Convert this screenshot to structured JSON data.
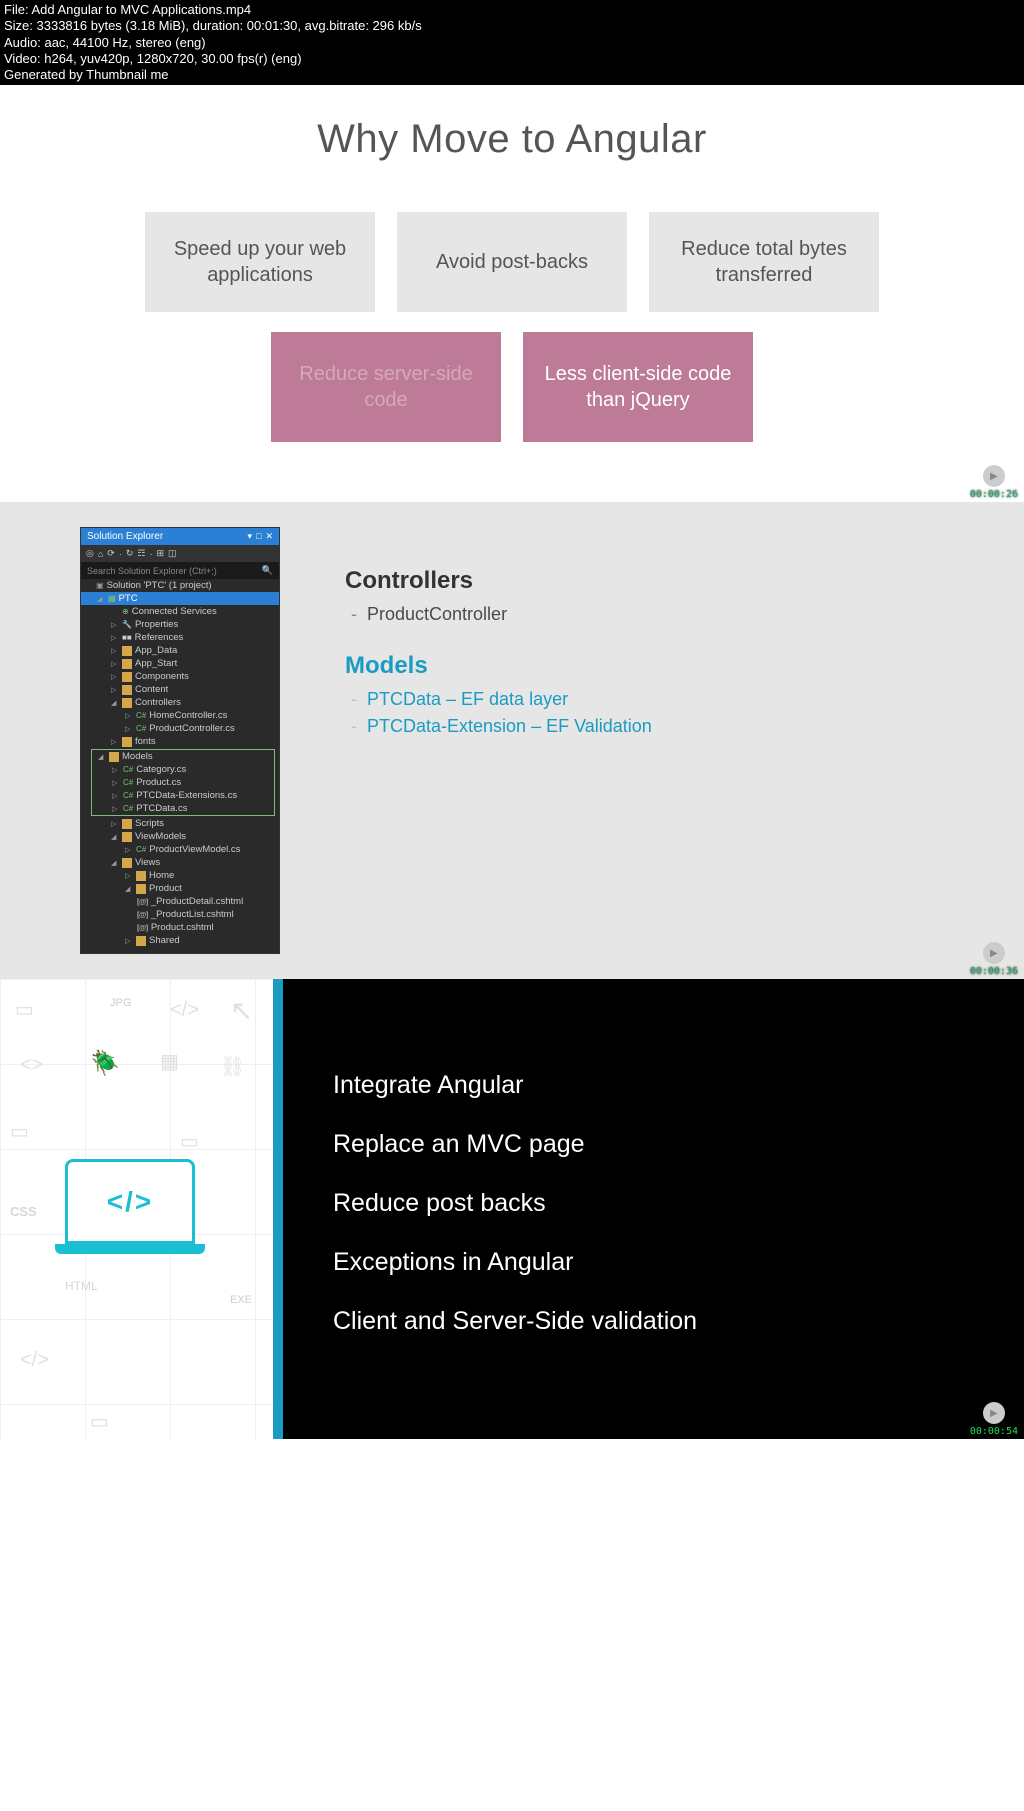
{
  "info": {
    "file_line": "File: Add Angular to MVC Applications.mp4",
    "size_line": "Size: 3333816 bytes (3.18 MiB), duration: 00:01:30, avg.bitrate: 296 kb/s",
    "audio_line": "Audio: aac, 44100 Hz, stereo (eng)",
    "video_line": "Video: h264, yuv420p, 1280x720, 30.00 fps(r) (eng)",
    "gen_line": "Generated by Thumbnail me"
  },
  "slide1": {
    "title": "Why Move to Angular",
    "cards_row1": {
      "c1": "Speed up your web applications",
      "c2": "Avoid post-backs",
      "c3": "Reduce total bytes transferred"
    },
    "cards_row2": {
      "c1": "Reduce server-side code",
      "c2": "Less client-side code than jQuery"
    },
    "timestamp": "00:00:26"
  },
  "slide2": {
    "explorer": {
      "title": "Solution Explorer",
      "search_placeholder": "Search Solution Explorer (Ctrl+;)",
      "solution": "Solution 'PTC' (1 project)",
      "project": "PTC",
      "items": {
        "connected": "Connected Services",
        "properties": "Properties",
        "references": "References",
        "app_data": "App_Data",
        "app_start": "App_Start",
        "components": "Components",
        "content": "Content",
        "controllers": "Controllers",
        "home_ctrl": "HomeController.cs",
        "prod_ctrl": "ProductController.cs",
        "fonts": "fonts",
        "models": "Models",
        "category": "Category.cs",
        "product": "Product.cs",
        "ptcext": "PTCData-Extensions.cs",
        "ptcdata": "PTCData.cs",
        "scripts": "Scripts",
        "viewmodels": "ViewModels",
        "prodvm": "ProductViewModel.cs",
        "views": "Views",
        "home": "Home",
        "product_folder": "Product",
        "proddetail": "_ProductDetail.cshtml",
        "prodlist": "_ProductList.cshtml",
        "prodcshtml": "Product.cshtml",
        "shared": "Shared"
      }
    },
    "text": {
      "controllers_h": "Controllers",
      "controllers_item": "ProductController",
      "models_h": "Models",
      "models_item1": "PTCData – EF data layer",
      "models_item2": "PTCData-Extension – EF Validation"
    },
    "timestamp": "00:00:36"
  },
  "slide3": {
    "items": {
      "i1": "Integrate Angular",
      "i2": "Replace an MVC page",
      "i3": "Reduce post backs",
      "i4": "Exceptions in Angular",
      "i5": "Client and Server-Side validation"
    },
    "timestamp": "00:00:54"
  },
  "deco_labels": {
    "jpg": "JPG",
    "css": "CSS",
    "html": "HTML",
    "exe": "EXE"
  }
}
